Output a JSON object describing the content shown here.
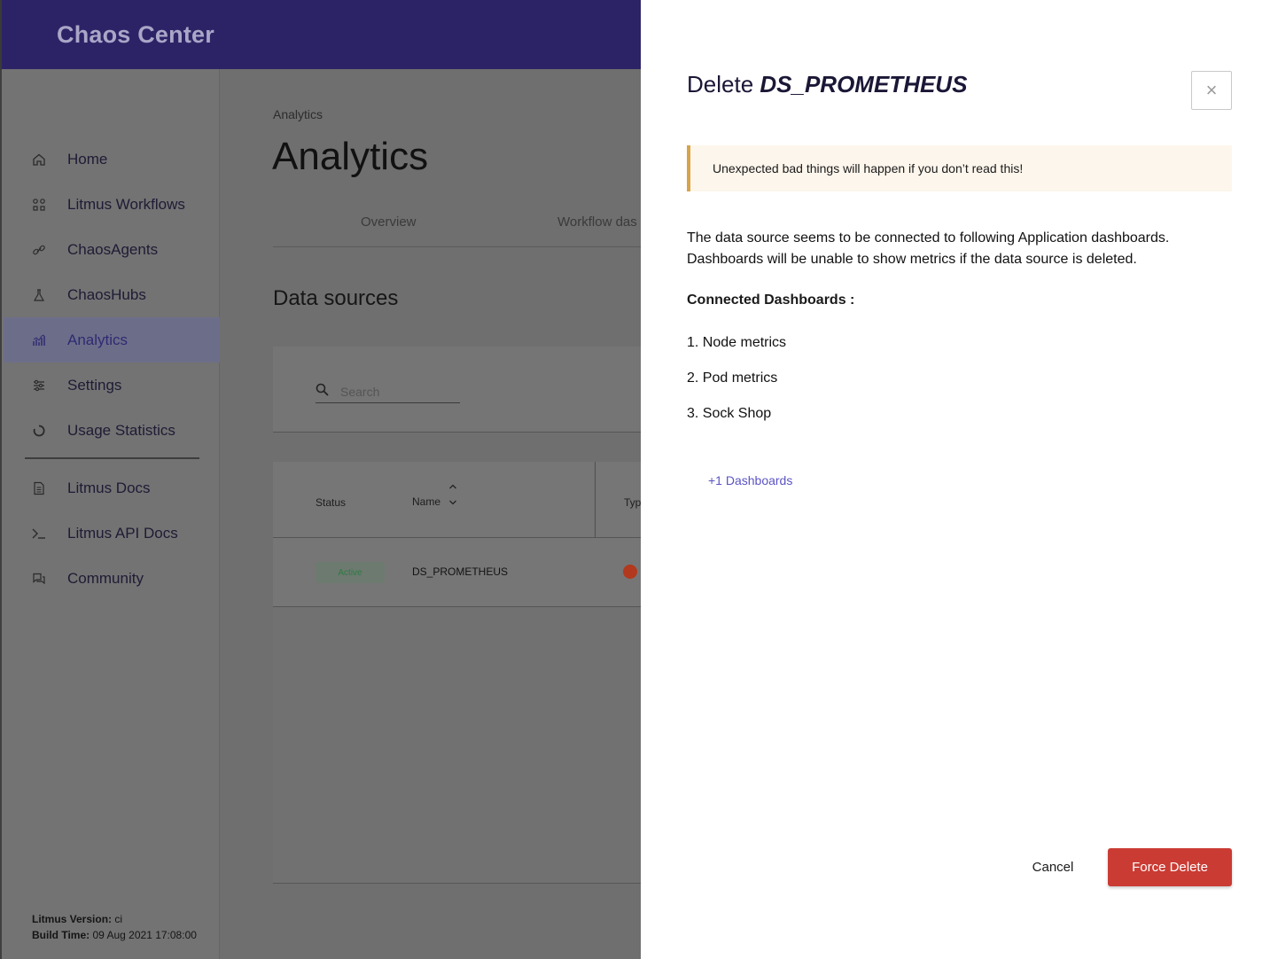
{
  "app": {
    "brand": "Chaos Center"
  },
  "sidebar": {
    "items": [
      {
        "label": "Home",
        "icon": "home-icon",
        "active": false
      },
      {
        "label": "Litmus Workflows",
        "icon": "workflows-icon",
        "active": false
      },
      {
        "label": "ChaosAgents",
        "icon": "link-icon",
        "active": false
      },
      {
        "label": "ChaosHubs",
        "icon": "flask-icon",
        "active": false
      },
      {
        "label": "Analytics",
        "icon": "analytics-icon",
        "active": true
      },
      {
        "label": "Settings",
        "icon": "sliders-icon",
        "active": false
      },
      {
        "label": "Usage Statistics",
        "icon": "usage-icon",
        "active": false
      },
      {
        "label": "Litmus Docs",
        "icon": "document-icon",
        "active": false
      },
      {
        "label": "Litmus API Docs",
        "icon": "terminal-icon",
        "active": false
      },
      {
        "label": "Community",
        "icon": "chat-icon",
        "active": false
      }
    ],
    "version_label": "Litmus Version:",
    "version_value": "ci",
    "build_label": "Build Time:",
    "build_value": "09 Aug 2021 17:08:00"
  },
  "main": {
    "breadcrumb": "Analytics",
    "title": "Analytics",
    "tabs": [
      "Overview",
      "Workflow das"
    ],
    "section_title": "Data sources",
    "search_placeholder": "Search",
    "table": {
      "headers": [
        "Status",
        "Name",
        "Typ"
      ],
      "rows": [
        {
          "status": "Active",
          "name": "DS_PROMETHEUS"
        }
      ]
    }
  },
  "drawer": {
    "title_prefix": "Delete",
    "title_name": "DS_PROMETHEUS",
    "close_symbol": "×",
    "warning": "Unexpected bad things will happen if you don’t read this!",
    "description_line1": "The data source seems to be connected to following Application dashboards.",
    "description_line2": "Dashboards will be unable to show metrics if the data source is deleted.",
    "connected_heading": "Connected Dashboards :",
    "dashboards": [
      "1. Node metrics",
      "2. Pod metrics",
      "3. Sock Shop"
    ],
    "more_link": "+1 Dashboards",
    "cancel_label": "Cancel",
    "force_delete_label": "Force Delete"
  },
  "colors": {
    "topbar": "#2c2367",
    "danger": "#ca3b33",
    "warning_border": "#d7a547",
    "link": "#5b54c4"
  }
}
